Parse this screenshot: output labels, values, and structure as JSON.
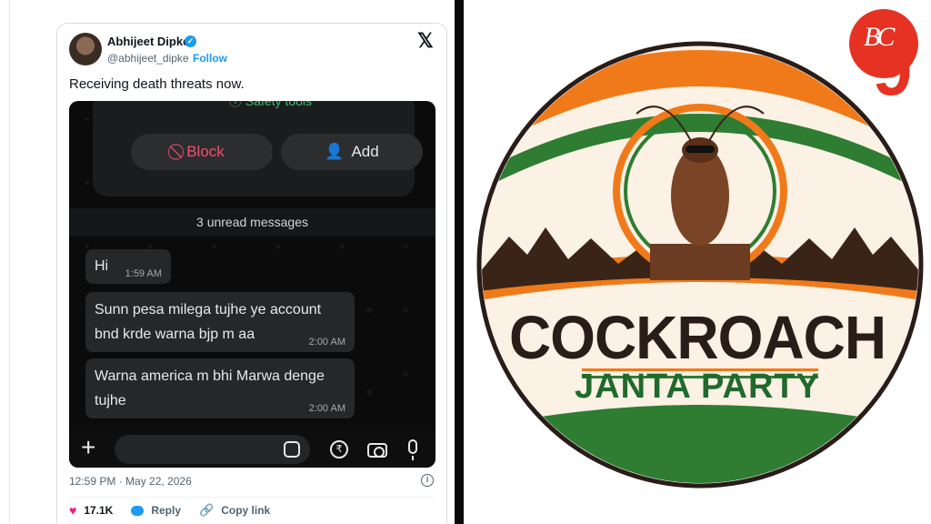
{
  "tweet": {
    "display_name": "Abhijeet Dipke",
    "handle": "@abhijeet_dipke",
    "separator": "·",
    "follow_label": "Follow",
    "x_logo": "𝕏",
    "text": "Receiving death threats now.",
    "timestamp": "12:59 PM · May 22, 2026",
    "likes": "17.1K",
    "reply_label": "Reply",
    "copy_link_label": "Copy link"
  },
  "chat": {
    "safety_tools": "ⓘ Safety tools",
    "block_label": "Block",
    "add_label": "Add",
    "unread": "3 unread messages",
    "messages": [
      {
        "text": "Hi",
        "time": "1:59 AM"
      },
      {
        "text": "Sunn pesa milega tujhe ye account bnd krde warna bjp m aa",
        "time": "2:00 AM"
      },
      {
        "text": "Warna america m bhi Marwa denge tujhe",
        "time": "2:00 AM"
      }
    ]
  },
  "logo": {
    "title": "COCKROACH",
    "subtitle": "JANTA PARTY",
    "colors": {
      "saffron": "#f07a1a",
      "green": "#2e7d32",
      "brown": "#3a2418"
    }
  },
  "watermark": {
    "letters": "BC",
    "number": "9",
    "color": "#e63222"
  }
}
